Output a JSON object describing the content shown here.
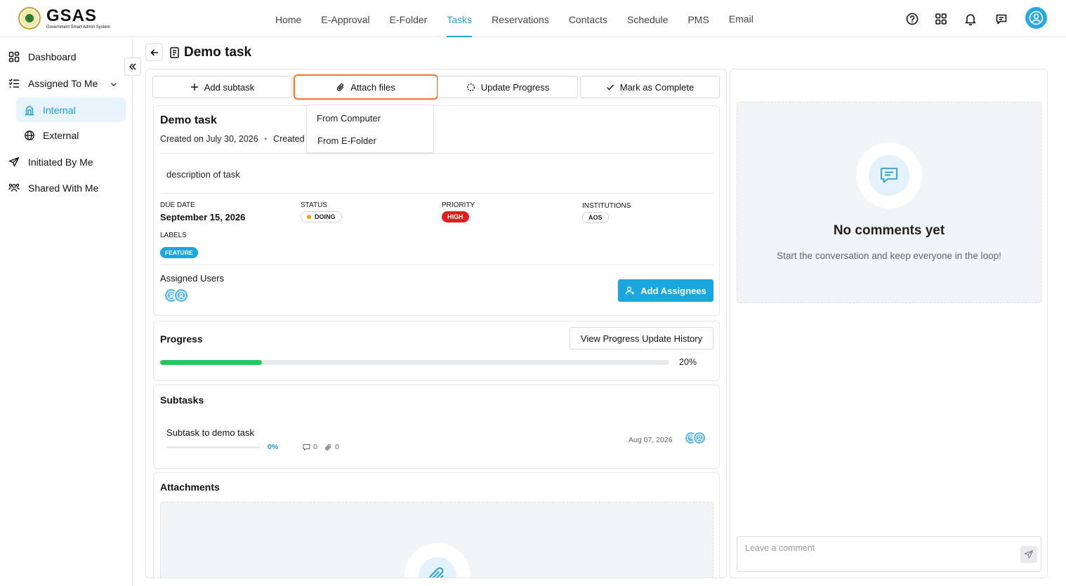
{
  "app": {
    "logo_title": "GSAS",
    "logo_subtitle": "Government Smart Admin System"
  },
  "nav": {
    "items": [
      "Home",
      "E-Approval",
      "E-Folder",
      "Tasks",
      "Reservations",
      "Contacts",
      "Schedule",
      "PMS",
      "Email"
    ],
    "active": "Tasks"
  },
  "sidebar": {
    "dashboard": "Dashboard",
    "assigned_to_me": "Assigned To Me",
    "internal": "Internal",
    "external": "External",
    "initiated_by_me": "Initiated By Me",
    "shared_with_me": "Shared With Me"
  },
  "page": {
    "title": "Demo task"
  },
  "toolbar": {
    "add_subtask": "Add subtask",
    "attach_files": "Attach files",
    "update_progress": "Update Progress",
    "mark_complete": "Mark as Complete"
  },
  "attach_menu": {
    "from_computer": "From Computer",
    "from_efolder": "From E-Folder"
  },
  "task": {
    "title": "Demo task",
    "created_on": "Created on July 30, 2026",
    "created_by": "Created by",
    "description": "description of task",
    "due_date_label": "DUE DATE",
    "due_date": "September 15, 2026",
    "status_label": "STATUS",
    "status": "DOING",
    "priority_label": "PRIORITY",
    "priority": "HIGH",
    "institutions_label": "INSTITUTIONS",
    "institution": "AOS",
    "labels_label": "LABELS",
    "label": "FEATURE",
    "assigned_users_label": "Assigned Users",
    "add_assignees": "Add Assignees"
  },
  "progress": {
    "title": "Progress",
    "history_button": "View Progress Update History",
    "value": 0.2,
    "value_text": "20%"
  },
  "subtasks": {
    "title": "Subtasks",
    "items": [
      {
        "name": "Subtask to demo task",
        "progress": 0,
        "progress_text": "0%",
        "comments": "0",
        "attachments": "0",
        "due": "Aug 07, 2026"
      }
    ]
  },
  "attachments": {
    "title": "Attachments"
  },
  "comments": {
    "empty_title": "No comments yet",
    "empty_subtitle": "Start the conversation and keep everyone in the loop!",
    "placeholder": "Leave a comment"
  },
  "colors": {
    "accent": "#22a7e0",
    "progress_green": "#22c55e",
    "priority_high": "#e11d1d",
    "status_dot": "#f59e0b",
    "highlight_orange": "#f47b3a"
  }
}
